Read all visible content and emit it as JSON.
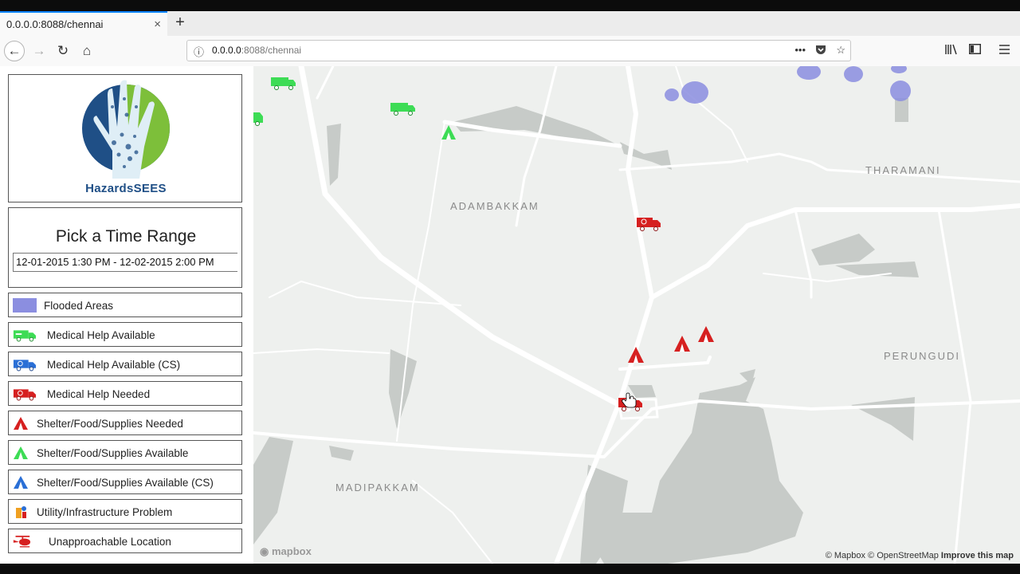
{
  "browser": {
    "tab_title": "0.0.0.0:8088/chennai",
    "tab_close": "×",
    "new_tab": "+",
    "url_host": "0.0.0.0",
    "url_rest": ":8088/chennai",
    "url_more": "•••",
    "back_glyph": "←",
    "forward_glyph": "→",
    "reload_glyph": "↻",
    "home_glyph": "⌂"
  },
  "sidebar": {
    "logo_text": "HazardsSEES",
    "time_title": "Pick a Time Range",
    "time_value": "12-01-2015 1:30 PM - 12-02-2015 2:00 PM",
    "legend": [
      {
        "label": "Flooded Areas",
        "icon": "flood-swatch"
      },
      {
        "label": "Medical Help Available",
        "icon": "green-ambulance-icon"
      },
      {
        "label": "Medical Help Available (CS)",
        "icon": "blue-ambulance-icon"
      },
      {
        "label": "Medical Help Needed",
        "icon": "red-ambulance-icon"
      },
      {
        "label": "Shelter/Food/Supplies Needed",
        "icon": "red-tent-icon"
      },
      {
        "label": "Shelter/Food/Supplies Available",
        "icon": "green-tent-icon"
      },
      {
        "label": "Shelter/Food/Supplies Available (CS)",
        "icon": "blue-tent-icon"
      },
      {
        "label": "Utility/Infrastructure Problem",
        "icon": "utility-icon"
      },
      {
        "label": "Unapproachable Location",
        "icon": "helicopter-icon"
      }
    ]
  },
  "map": {
    "places": [
      "ADAMBAKKAM",
      "THARAMANI",
      "PERUNGUDI",
      "MADIPAKKAM"
    ],
    "attribution_osm": "© Mapbox © OpenStreetMap",
    "improve": "Improve this map",
    "mapbox_logo": "mapbox"
  },
  "colors": {
    "flood": "#8b8ee0",
    "medical_available": "#3ddc55",
    "medical_needed": "#d62020",
    "cs_blue": "#2a6fd6"
  }
}
